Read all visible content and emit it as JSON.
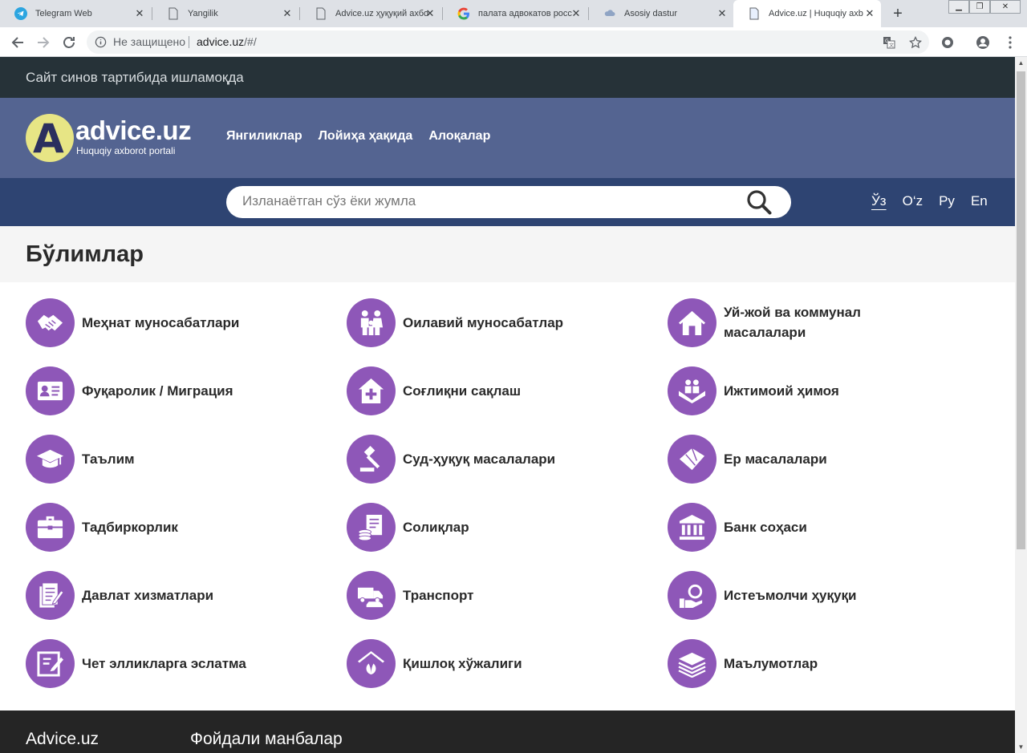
{
  "browser": {
    "tabs": [
      {
        "title": "Telegram Web",
        "icon": "telegram-icon"
      },
      {
        "title": "Yangilik",
        "icon": "page-icon"
      },
      {
        "title": "Advice.uz ҳуқуқий ахбо",
        "icon": "page-icon"
      },
      {
        "title": "палата адвокатов росс",
        "icon": "google-icon"
      },
      {
        "title": "Asosiy dastur",
        "icon": "cloud-icon"
      },
      {
        "title": "Advice.uz | Huquqiy axb",
        "icon": "page-icon"
      }
    ],
    "security_label": "Не защищено",
    "url_domain": "advice.uz",
    "url_path": "/#/"
  },
  "notice": {
    "text": "Сайт синов тартибида ишламоқда"
  },
  "header": {
    "logo_letter": "A",
    "logo_name": "advice.uz",
    "logo_subtitle": "Huquqiy axborot portali",
    "nav": [
      "Янгиликлар",
      "Лойиҳа ҳақида",
      "Алоқалар"
    ]
  },
  "search": {
    "placeholder": "Изланаётган сўз ёки жумла"
  },
  "languages": {
    "items": [
      "Ўз",
      "O‘z",
      "Ру",
      "En"
    ],
    "active": "Ўз"
  },
  "sections": {
    "title": "Бўлимлар",
    "items": [
      {
        "label": "Меҳнат муносабатлари",
        "icon": "handshake-icon"
      },
      {
        "label": "Оилавий муносабатлар",
        "icon": "family-icon"
      },
      {
        "label": "Уй-жой ва коммунал масалалари",
        "icon": "house-icon"
      },
      {
        "label": "Фуқаролик / Миграция",
        "icon": "id-card-icon"
      },
      {
        "label": "Соғлиқни сақлаш",
        "icon": "hospital-icon"
      },
      {
        "label": "Ижтимоий ҳимоя",
        "icon": "social-protection-icon"
      },
      {
        "label": "Таълим",
        "icon": "graduation-cap-icon"
      },
      {
        "label": "Суд-ҳуқуқ масалалари",
        "icon": "gavel-icon"
      },
      {
        "label": "Ер масалалари",
        "icon": "land-icon"
      },
      {
        "label": "Тадбиркорлик",
        "icon": "briefcase-icon"
      },
      {
        "label": "Солиқлар",
        "icon": "tax-icon"
      },
      {
        "label": "Банк соҳаси",
        "icon": "bank-icon"
      },
      {
        "label": "Давлат хизматлари",
        "icon": "documents-icon"
      },
      {
        "label": "Транспорт",
        "icon": "transport-icon"
      },
      {
        "label": "Истеъмолчи ҳуқуқи",
        "icon": "consumer-icon"
      },
      {
        "label": "Чет элликларга эслатма",
        "icon": "note-icon"
      },
      {
        "label": "Қишлоқ хўжалиги",
        "icon": "agriculture-icon"
      },
      {
        "label": "Маълумотлар",
        "icon": "layers-icon"
      }
    ]
  },
  "footer": {
    "col1": "Advice.uz",
    "col2": "Фойдали манбалар"
  },
  "colors": {
    "accent": "#8e57b8",
    "header": "#546491",
    "searchbar": "#2e4472",
    "notice": "#263238"
  }
}
